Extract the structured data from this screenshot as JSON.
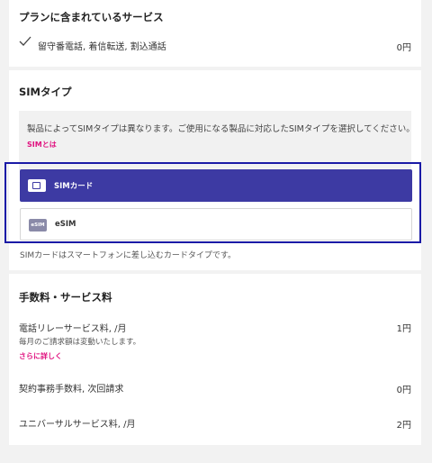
{
  "plan_services": {
    "title": "プランに含まれているサービス",
    "item_label": "留守番電話, 着信転送, 割込通話",
    "item_price": "0円"
  },
  "sim_type": {
    "title": "SIMタイプ",
    "info_text": "製品によってSIMタイプは異なります。ご使用になる製品に対応したSIMタイプを選択してください。",
    "info_link": "SIMとは",
    "options": [
      {
        "label": "SIMカード",
        "selected": true,
        "icon": "sim-card-icon"
      },
      {
        "label": "eSIM",
        "selected": false,
        "icon": "esim-icon",
        "icon_text": "eSIM"
      }
    ],
    "note": "SIMカードはスマートフォンに差し込むカードタイプです。",
    "selected_color": "#3d3aa3"
  },
  "fees": {
    "title": "手数料・サービス料",
    "items": [
      {
        "label": "電話リレーサービス料, /月",
        "price": "1円",
        "sub": "毎月のご請求額は変動いたします。",
        "link": "さらに詳しく"
      },
      {
        "label": "契約事務手数料, 次回請求",
        "price": "0円"
      },
      {
        "label": "ユニバーサルサービス料, /月",
        "price": "2円"
      }
    ]
  },
  "accent_pink": "#e0117f"
}
